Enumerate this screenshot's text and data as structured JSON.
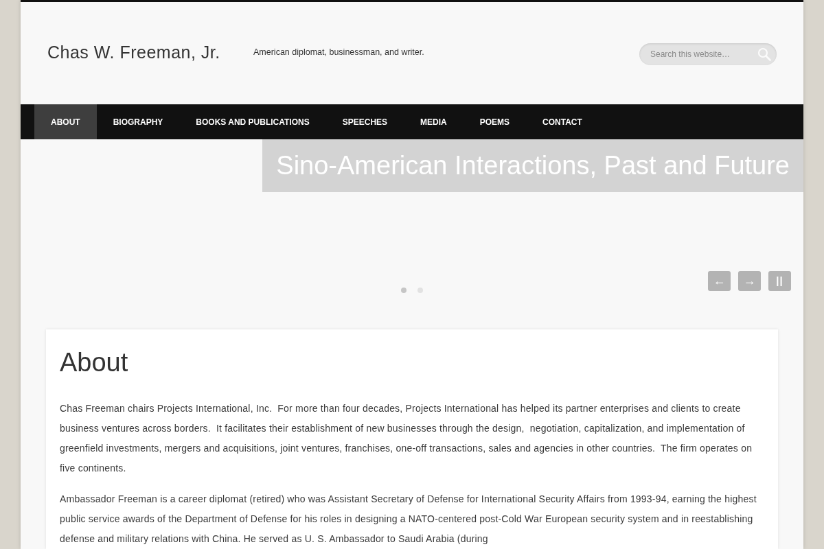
{
  "site": {
    "title": "Chas W. Freeman, Jr.",
    "tagline": "American diplomat, businessman, and writer."
  },
  "search": {
    "placeholder": "Search this website…"
  },
  "nav": [
    {
      "label": "ABOUT",
      "selected": true
    },
    {
      "label": "BIOGRAPHY",
      "selected": false
    },
    {
      "label": "BOOKS AND PUBLICATIONS",
      "selected": false
    },
    {
      "label": "SPEECHES",
      "selected": false
    },
    {
      "label": "MEDIA",
      "selected": false
    },
    {
      "label": "POEMS",
      "selected": false
    },
    {
      "label": "CONTACT",
      "selected": false
    }
  ],
  "slider": {
    "title": "Sino-American Interactions, Past and Future",
    "controls": [
      {
        "kind": "prev",
        "label": "←"
      },
      {
        "kind": "next",
        "label": "→"
      },
      {
        "kind": "pause",
        "label": "||"
      }
    ],
    "pager": [
      {
        "selected": true
      },
      {
        "selected": false
      }
    ]
  },
  "page": {
    "heading": "About",
    "paragraphs": [
      "Chas Freeman chairs Projects International, Inc.  For more than four decades, Projects International has helped its partner enterprises and clients to create business ventures across borders.  It facilitates their establishment of new businesses through the design,  negotiation, capitalization, and implementation of greenfield investments, mergers and acquisitions, joint ventures, franchises, one-off transactions, sales and agencies in other countries.  The firm operates on five continents.",
      "Ambassador Freeman is a career diplomat (retired) who was Assistant Secretary of Defense for International Security Affairs from 1993-94, earning the highest public service awards of the Department of Defense for his roles in designing a NATO-centered post-Cold War European security system and in reestablishing defense and military relations with China. He served as U. S. Ambassador to Saudi Arabia (during"
    ]
  }
}
